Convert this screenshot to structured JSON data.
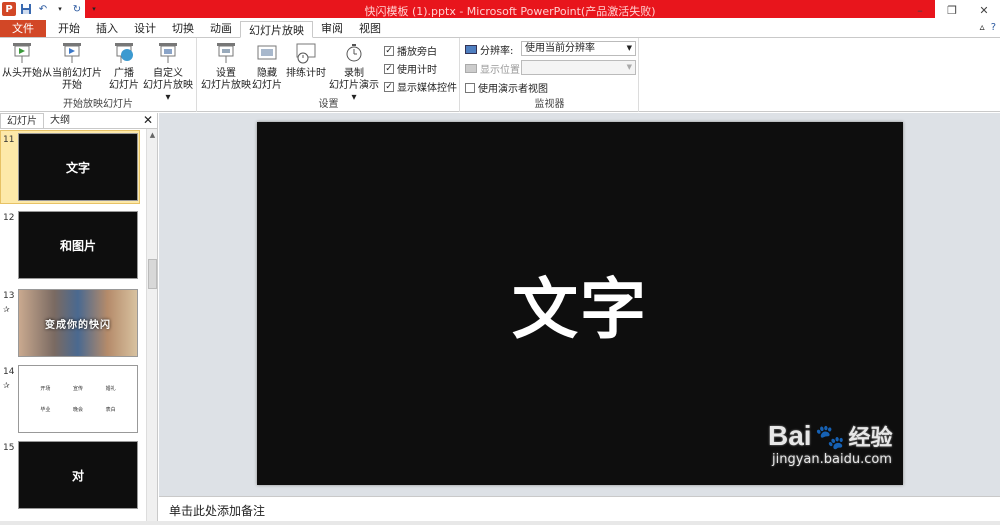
{
  "window": {
    "title": "快闪模板 (1).pptx - Microsoft PowerPoint(产品激活失败)"
  },
  "tabs": [
    {
      "label": "文件"
    },
    {
      "label": "开始"
    },
    {
      "label": "插入"
    },
    {
      "label": "设计"
    },
    {
      "label": "切换"
    },
    {
      "label": "动画"
    },
    {
      "label": "幻灯片放映"
    },
    {
      "label": "审阅"
    },
    {
      "label": "视图"
    }
  ],
  "ribbon": {
    "group_start": {
      "label": "开始放映幻灯片",
      "from_start": "从头开始",
      "from_current_1": "从当前幻灯片",
      "from_current_2": "开始",
      "broadcast_1": "广播",
      "broadcast_2": "幻灯片",
      "custom_1": "自定义",
      "custom_2": "幻灯片放映"
    },
    "group_setup": {
      "label": "设置",
      "setup_1": "设置",
      "setup_2": "幻灯片放映",
      "hide_1": "隐藏",
      "hide_2": "幻灯片",
      "rehearse": "排练计时",
      "record_1": "录制",
      "record_2": "幻灯片演示",
      "play_narration": "播放旁白",
      "use_timings": "使用计时",
      "show_media": "显示媒体控件"
    },
    "group_monitor": {
      "label": "监视器",
      "resolution_label": "分辨率:",
      "resolution_value": "使用当前分辨率",
      "show_on_label": "显示位置:",
      "presenter_view": "使用演示者视图"
    }
  },
  "left_panel": {
    "tab_slides": "幻灯片",
    "tab_outline": "大纲",
    "slides": [
      {
        "num": "11",
        "text": "文字"
      },
      {
        "num": "12",
        "text": "和图片"
      },
      {
        "num": "13",
        "text": "变成你的快闪"
      },
      {
        "num": "14",
        "text": "",
        "cells": [
          "开场",
          "宣传",
          "婚礼",
          "毕业",
          "晚会",
          "表白"
        ]
      },
      {
        "num": "15",
        "text": "对"
      }
    ]
  },
  "slide": {
    "text": "文字"
  },
  "notes": {
    "placeholder": "单击此处添加备注"
  },
  "watermark": {
    "line1": "Bai",
    "line1b": "经验",
    "line2": "jingyan.baidu.com"
  }
}
